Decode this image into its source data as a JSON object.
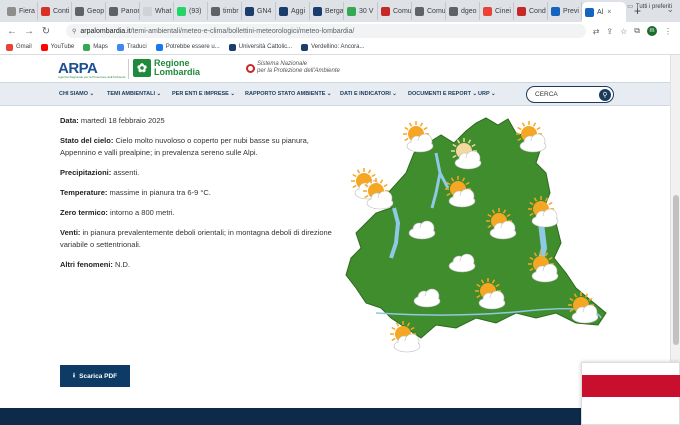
{
  "browser": {
    "tabs": [
      {
        "label": "Fiera",
        "color": "#8e8e8e",
        "icon": "globe-icon"
      },
      {
        "label": "Conti",
        "color": "#d93025",
        "icon": "chat-icon"
      },
      {
        "label": "Geop",
        "color": "#5f6368",
        "icon": "globe-icon"
      },
      {
        "label": "Panor",
        "color": "#5f6368",
        "icon": "globe-icon"
      },
      {
        "label": "What",
        "color": "#cfd3d7",
        "icon": "whatsapp-icon"
      },
      {
        "label": "(93)",
        "color": "#25d366",
        "icon": "whatsapp-icon"
      },
      {
        "label": "timbr",
        "color": "#5f6368",
        "icon": "globe-icon"
      },
      {
        "label": "GN4",
        "color": "#1a3d6d",
        "icon": "gn4-icon"
      },
      {
        "label": "Aggi",
        "color": "#1a3d6d",
        "icon": "gn4-icon"
      },
      {
        "label": "Berga",
        "color": "#1a3d6d",
        "icon": "gn4-icon"
      },
      {
        "label": "30 V",
        "color": "#34a853",
        "icon": "maps-icon"
      },
      {
        "label": "Comu",
        "color": "#c62828",
        "icon": "globe-icon"
      },
      {
        "label": "Comu",
        "color": "#5f6368",
        "icon": "globe-icon"
      },
      {
        "label": "dgeo",
        "color": "#5f6368",
        "icon": "globe-icon"
      },
      {
        "label": "Cinei",
        "color": "#ea4335",
        "icon": "doc-icon"
      },
      {
        "label": "Cond",
        "color": "#c62828",
        "icon": "pdf-icon"
      },
      {
        "label": "Previ",
        "color": "#1565c0",
        "icon": "arpa-icon"
      },
      {
        "label": "Al",
        "color": "#1565c0",
        "icon": "arpa-icon",
        "active": true
      }
    ],
    "new_tab_glyph": "+",
    "url_host": "arpalombardia.it",
    "url_path": "/temi-ambientali/meteo-e-clima/bollettini-meteorologici/meteo-lombardia/",
    "avatar_letter": "m",
    "bookmarks": [
      {
        "label": "Gmail",
        "color": "#ea4335"
      },
      {
        "label": "YouTube",
        "color": "#ff0000"
      },
      {
        "label": "Maps",
        "color": "#34a853"
      },
      {
        "label": "Traduci",
        "color": "#4285f4"
      },
      {
        "label": "Potrebbe essere u...",
        "color": "#1877f2"
      },
      {
        "label": "Università Cattolic...",
        "color": "#1a3d6d"
      },
      {
        "label": "Verdellino: Ancora...",
        "color": "#1a3d6d"
      }
    ],
    "bookmarks_right": "Tutti i preferiti"
  },
  "site": {
    "arpa_logo": "ARPA",
    "arpa_sub": "Agenzia Regionale per la Protezione dell'Ambiente",
    "regione_line1": "Regione",
    "regione_line2": "Lombardia",
    "snpa_line1": "Sistema Nazionale",
    "snpa_line2": "per la Protezione dell'Ambiente",
    "nav": [
      {
        "label": "CHI SIAMO",
        "name": "nav-chi-siamo"
      },
      {
        "label": "TEMI AMBIENTALI",
        "name": "nav-temi-ambientali"
      },
      {
        "label": "PER ENTI E IMPRESE",
        "name": "nav-enti-imprese"
      },
      {
        "label": "RAPPORTO STATO AMBIENTE",
        "name": "nav-rapporto"
      },
      {
        "label": "DATI E INDICATORI",
        "name": "nav-dati"
      },
      {
        "label": "DOCUMENTI E REPORT",
        "name": "nav-documenti"
      },
      {
        "label": "URP",
        "name": "nav-urp"
      }
    ],
    "search_placeholder": "CERCA"
  },
  "bulletin": {
    "data_label": "Data:",
    "data_value": "martedì 18 febbraio 2025",
    "cielo_label": "Stato del cielo:",
    "cielo_value": "Cielo molto nuvoloso o coperto per nubi basse su pianura, Appennino e valli prealpine; in prevalenza sereno sulle Alpi.",
    "precip_label": "Precipitazioni:",
    "precip_value": "assenti.",
    "temp_label": "Temperature:",
    "temp_value": "massime in pianura tra 6-9 °C.",
    "zero_label": "Zero termico:",
    "zero_value": "intorno a 800 metri.",
    "venti_label": "Venti:",
    "venti_value": "in pianura prevalentemente deboli orientali; in montagna deboli di direzione variabile o settentrionali.",
    "altri_label": "Altri fenomeni:",
    "altri_value": "N.D.",
    "pdf_button": "Scarica PDF"
  },
  "map": {
    "land_color": "#3f8d2c",
    "water_color": "#8fc9e6",
    "icons": [
      {
        "type": "sun-cloud"
      },
      {
        "type": "cloud-sun-pale"
      },
      {
        "type": "sun-cloud"
      },
      {
        "type": "sun-cloud"
      },
      {
        "type": "sun-cloud"
      },
      {
        "type": "sun-cloud"
      },
      {
        "type": "cloud"
      },
      {
        "type": "sun-cloud"
      },
      {
        "type": "sun-cloud"
      },
      {
        "type": "cloud"
      },
      {
        "type": "sun-cloud"
      },
      {
        "type": "cloud"
      },
      {
        "type": "sun-cloud"
      },
      {
        "type": "sun-cloud"
      },
      {
        "type": "sun-cloud"
      }
    ]
  }
}
